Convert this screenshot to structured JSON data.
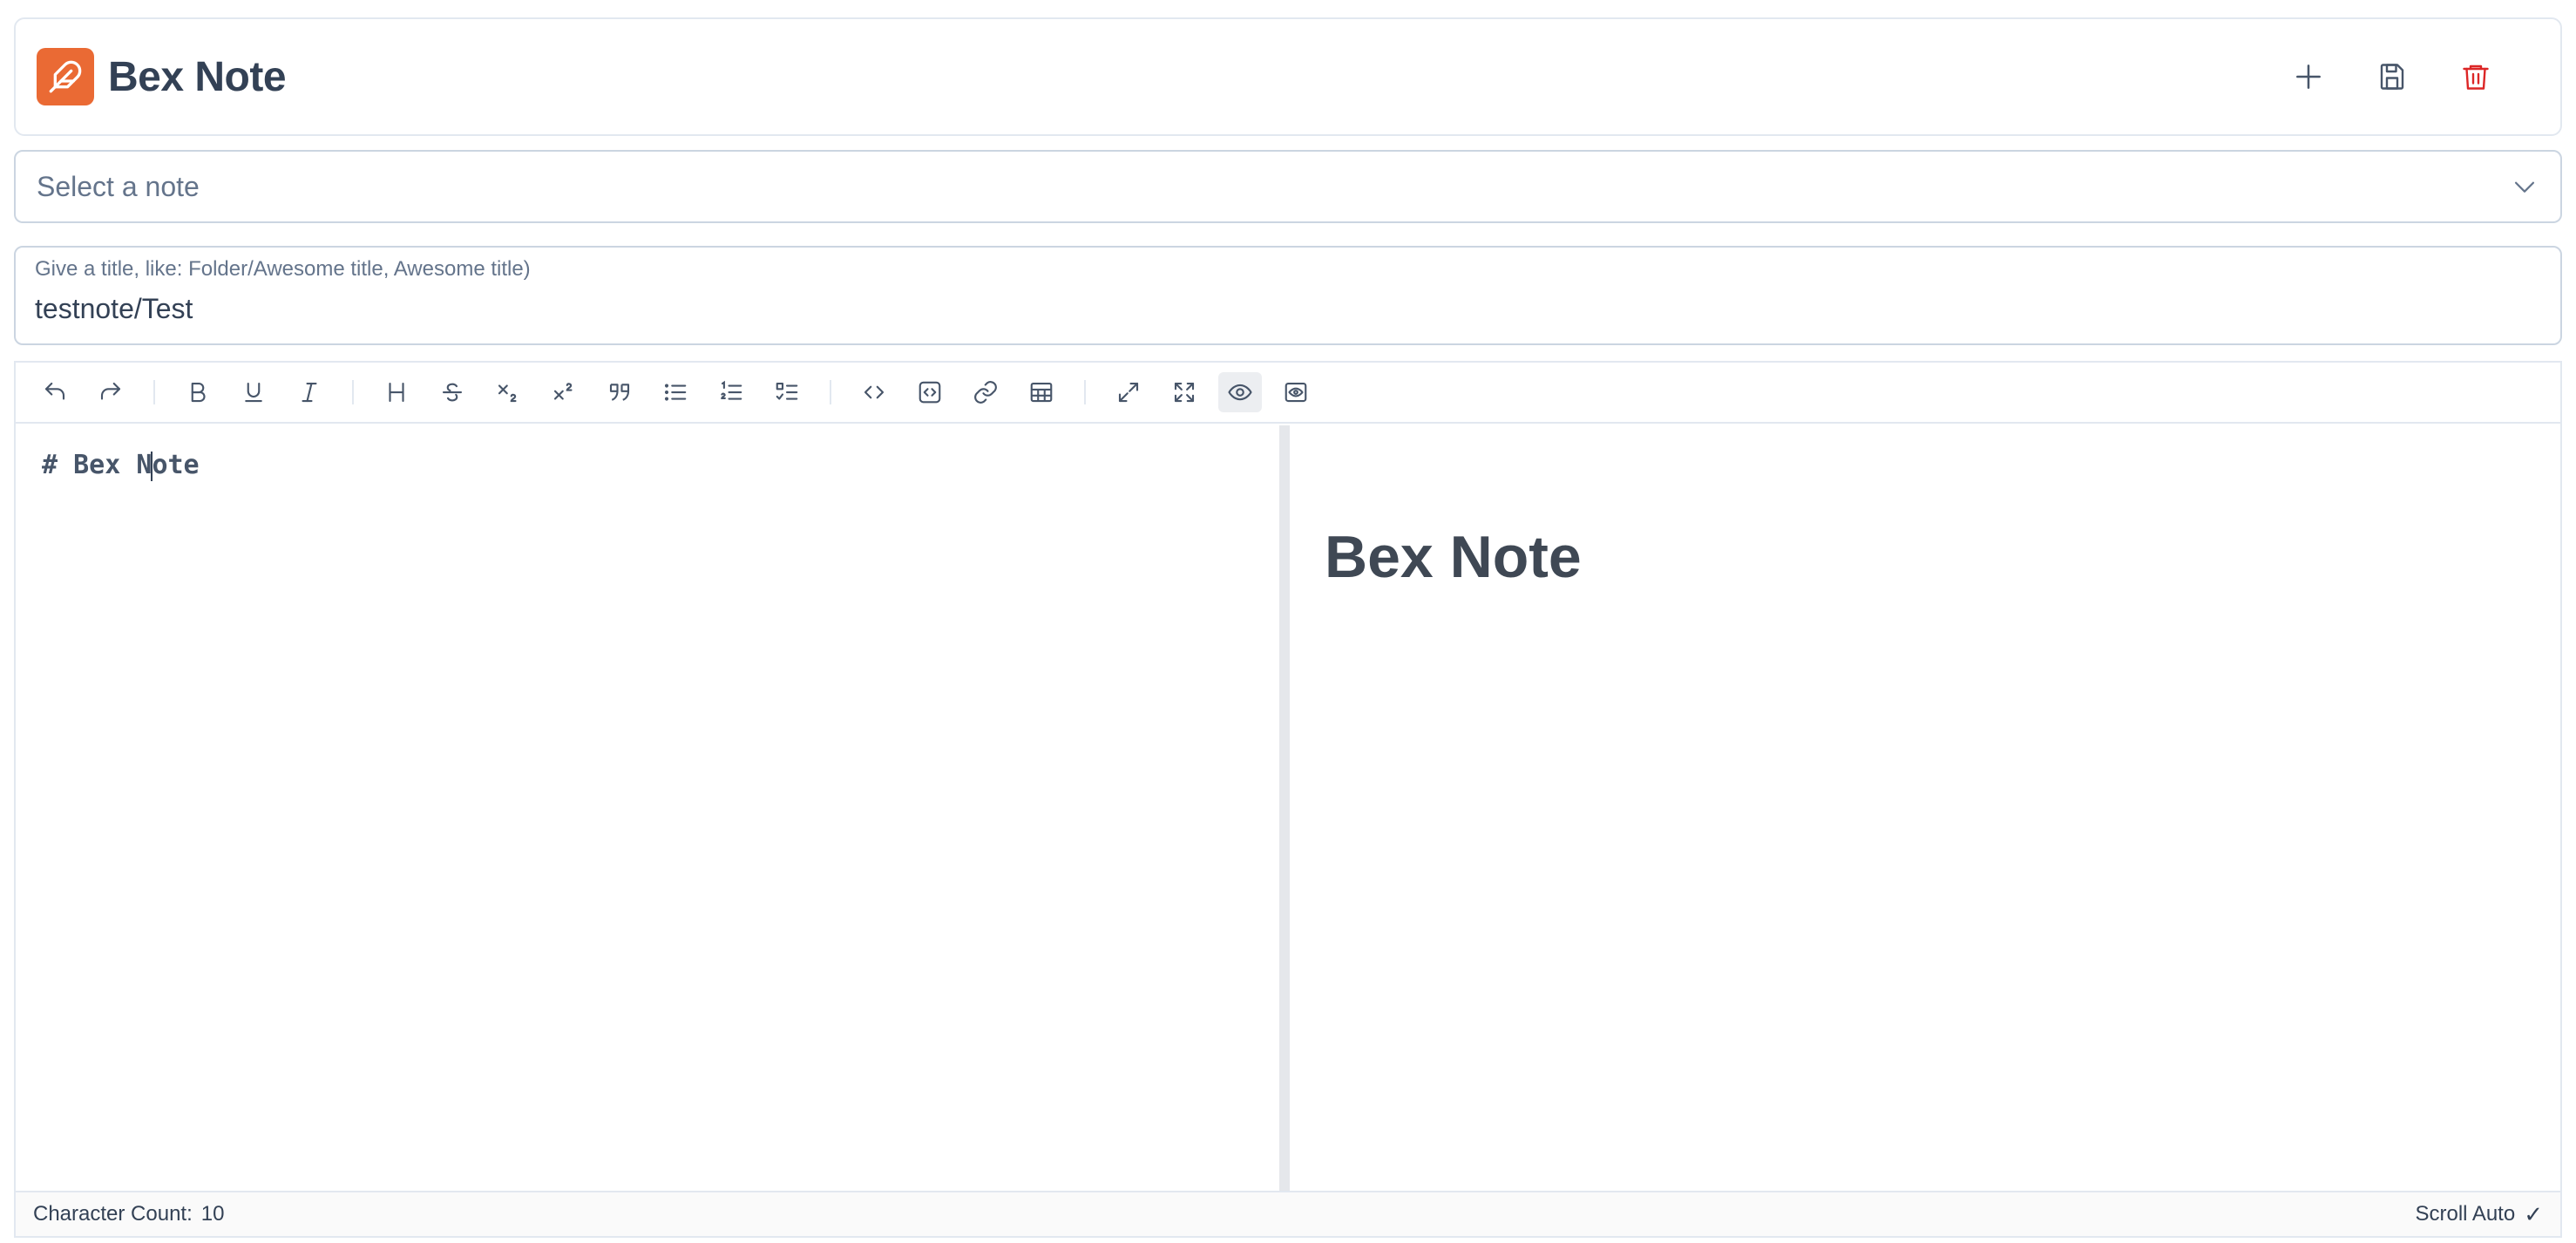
{
  "app": {
    "title": "Bex Note",
    "brand_color": "#ea6a34",
    "logo_icon": "feather-icon"
  },
  "header_actions": [
    {
      "name": "new-note-button",
      "icon": "plus-icon"
    },
    {
      "name": "save-note-button",
      "icon": "save-icon"
    },
    {
      "name": "delete-note-button",
      "icon": "trash-icon",
      "color": "#dc2626"
    }
  ],
  "note_select": {
    "placeholder": "Select a note"
  },
  "title_field": {
    "hint": "Give a title, like: Folder/Awesome title, Awesome title)",
    "value": "testnote/Test"
  },
  "editor": {
    "source_before_caret": "# Bex N",
    "source_after_caret": "ote",
    "preview_heading": "Bex Note",
    "active_tool": "preview"
  },
  "footer": {
    "character_count_label": "Character Count:",
    "character_count": "10",
    "scroll_auto_label": "Scroll Auto",
    "scroll_auto_checked": "✓"
  }
}
